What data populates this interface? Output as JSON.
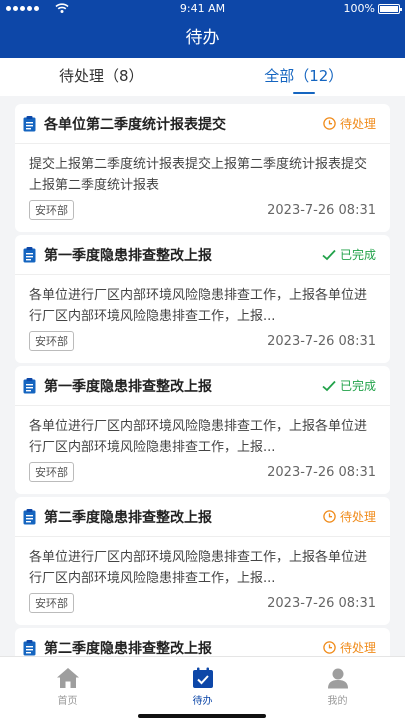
{
  "statusbar": {
    "time": "9:41 AM",
    "battery": "100%"
  },
  "navbar": {
    "title": "待办"
  },
  "tabs": [
    {
      "label": "待处理（8）"
    },
    {
      "label": "全部（12）"
    }
  ],
  "status_labels": {
    "pending": "待处理",
    "done": "已完成"
  },
  "colors": {
    "primary": "#0d47a8",
    "pending": "#f08c1c",
    "done": "#22a24a"
  },
  "cards": [
    {
      "title": "各单位第二季度统计报表提交",
      "status": "待处理",
      "status_type": "pending",
      "body": "提交上报第二季度统计报表提交上报第二季度统计报表提交上报第二季度统计报表",
      "dept": "安环部",
      "date": "2023-7-26  08:31"
    },
    {
      "title": "第一季度隐患排查整改上报",
      "status": "已完成",
      "status_type": "done",
      "body": "各单位进行厂区内部环境风险隐患排查工作，上报各单位进行厂区内部环境风险隐患排查工作，上报...",
      "dept": "安环部",
      "date": "2023-7-26  08:31"
    },
    {
      "title": "第一季度隐患排查整改上报",
      "status": "已完成",
      "status_type": "done",
      "body": "各单位进行厂区内部环境风险隐患排查工作，上报各单位进行厂区内部环境风险隐患排查工作，上报...",
      "dept": "安环部",
      "date": "2023-7-26  08:31"
    },
    {
      "title": "第二季度隐患排查整改上报",
      "status": "待处理",
      "status_type": "pending",
      "body": "各单位进行厂区内部环境风险隐患排查工作，上报各单位进行厂区内部环境风险隐患排查工作，上报...",
      "dept": "安环部",
      "date": "2023-7-26  08:31"
    },
    {
      "title": "第二季度隐患排查整改上报",
      "status": "待处理",
      "status_type": "pending",
      "body": "",
      "dept": "",
      "date": ""
    }
  ],
  "tabbar": [
    {
      "label": "首页",
      "icon": "home-icon"
    },
    {
      "label": "待办",
      "icon": "calendar-check-icon"
    },
    {
      "label": "我的",
      "icon": "user-icon"
    }
  ]
}
